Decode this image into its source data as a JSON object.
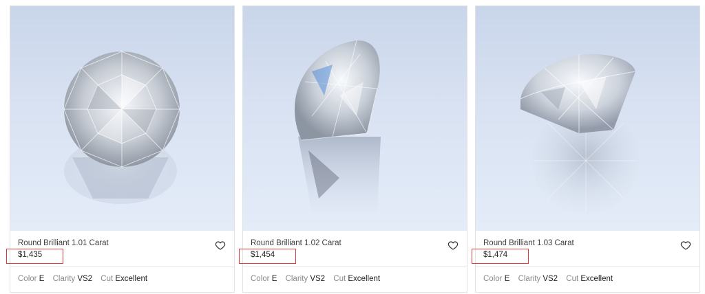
{
  "products": [
    {
      "title": "Round Brilliant 1.01 Carat",
      "price": "$1,435",
      "specs": {
        "color_label": "Color",
        "color_value": "E",
        "clarity_label": "Clarity",
        "clarity_value": "VS2",
        "cut_label": "Cut",
        "cut_value": "Excellent"
      }
    },
    {
      "title": "Round Brilliant 1.02 Carat",
      "price": "$1,454",
      "specs": {
        "color_label": "Color",
        "color_value": "E",
        "clarity_label": "Clarity",
        "clarity_value": "VS2",
        "cut_label": "Cut",
        "cut_value": "Excellent"
      }
    },
    {
      "title": "Round Brilliant 1.03 Carat",
      "price": "$1,474",
      "specs": {
        "color_label": "Color",
        "color_value": "E",
        "clarity_label": "Clarity",
        "clarity_value": "VS2",
        "cut_label": "Cut",
        "cut_value": "Excellent"
      }
    }
  ],
  "icons": {
    "favorite": "heart-outline-icon"
  },
  "colors": {
    "highlight_box": "#e0393b",
    "image_background": "#d8e2f2"
  }
}
